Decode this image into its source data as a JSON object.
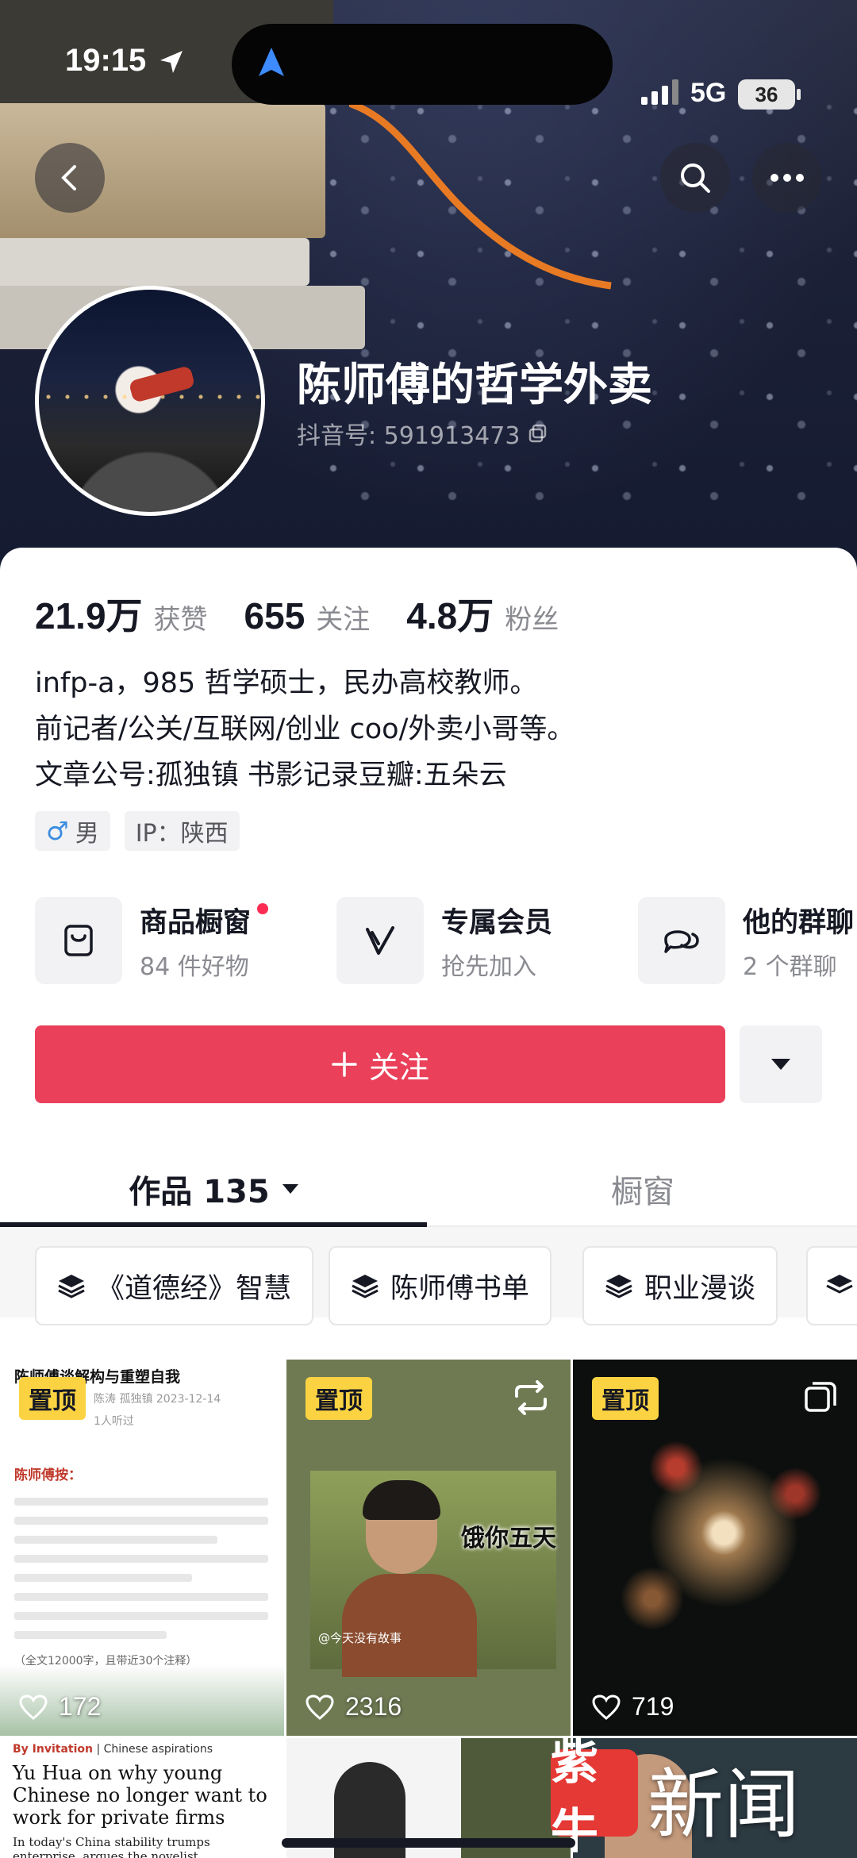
{
  "status_bar": {
    "time": "19:15",
    "network": "5G",
    "battery": "36"
  },
  "header": {
    "nickname": "陈师傅的哲学外卖",
    "douyin_id": "抖音号: 591913473"
  },
  "stats": [
    {
      "value": "21.9万",
      "label": "获赞"
    },
    {
      "value": "655",
      "label": "关注"
    },
    {
      "value": "4.8万",
      "label": "粉丝"
    }
  ],
  "bio": [
    "infp-a，985 哲学硕士，民办高校教师。",
    "前记者/公关/互联网/创业 coo/外卖小哥等。",
    "文章公号:孤独镇   书影记录豆瓣:五朵云"
  ],
  "tags": {
    "gender": "男",
    "ip": "IP：陕西"
  },
  "services": [
    {
      "title": "商品橱窗",
      "subtitle": "84 件好物",
      "icon": "bag-icon"
    },
    {
      "title": "专属会员",
      "subtitle": "抢先加入",
      "icon": "v-icon"
    },
    {
      "title": "他的群聊",
      "subtitle": "2 个群聊",
      "icon": "chat-icon"
    }
  ],
  "actions": {
    "follow_label": "关注"
  },
  "tabs": {
    "works": "作品 135",
    "shop": "橱窗"
  },
  "collections": [
    "《道德经》智慧",
    "陈师傅书单",
    "职业漫谈"
  ],
  "videos": [
    {
      "pinned_label": "置顶",
      "likes": "172",
      "doc_title": "陈师傅谈解构与重塑自我",
      "doc_meta": "陈涛  孤独镇  2023-12-14",
      "doc_listen": "1人听过",
      "doc_heading": "陈师傅按：",
      "doc_footer": "（全文12000字，且带近30个注释）"
    },
    {
      "pinned_label": "置顶",
      "likes": "2316",
      "caption": "饿你五天",
      "watermark": "@今天没有故事"
    },
    {
      "pinned_label": "置顶",
      "likes": "719"
    }
  ],
  "bottom_row": {
    "news_byline_tag": "By Invitation",
    "news_byline": "Chinese aspirations",
    "news_headline": "Yu Hua on why young Chinese no longer want to work for private firms",
    "news_sub": "In today's China stability trumps enterprise, argues the novelist"
  },
  "logo": {
    "mark": "紫牛",
    "text": "新闻"
  },
  "colors": {
    "follow": "#ea4059",
    "pin": "#fbd342",
    "accent_dot": "#fe2c55"
  }
}
